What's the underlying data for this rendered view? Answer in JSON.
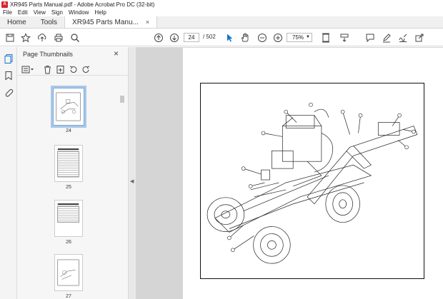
{
  "window": {
    "title": "XR945 Parts Manual.pdf - Adobe Acrobat Pro DC (32-bit)",
    "app_icon_glyph": "A"
  },
  "menu": [
    "File",
    "Edit",
    "View",
    "Sign",
    "Window",
    "Help"
  ],
  "tabs": [
    {
      "label": "Home"
    },
    {
      "label": "Tools"
    },
    {
      "label": "XR945 Parts Manu...",
      "close": "×"
    }
  ],
  "toolbar": {
    "current_page": "24",
    "total_pages": "/ 502",
    "zoom": "75%"
  },
  "thumbnails_panel": {
    "title": "Page Thumbnails",
    "close": "×",
    "pages": [
      "24",
      "25",
      "26",
      "27"
    ]
  },
  "icons": {
    "toolbar": [
      "bookmark-star-icon",
      "upload-icon",
      "print-icon",
      "search-zoom-icon",
      "page-up-icon",
      "page-down-icon",
      "select-arrow-icon",
      "hand-icon",
      "zoom-out-icon",
      "zoom-in-icon",
      "page-fit-icon",
      "scroll-mode-icon",
      "comment-icon",
      "pen-icon",
      "sign-icon",
      "share-icon"
    ],
    "left_rail": [
      "page-thumbnails-icon",
      "bookmarks-icon",
      "attachments-icon"
    ]
  },
  "colors": {
    "accent": "#1a73c8",
    "selection": "#a9c7e8",
    "acrobat_red": "#d8242b"
  }
}
